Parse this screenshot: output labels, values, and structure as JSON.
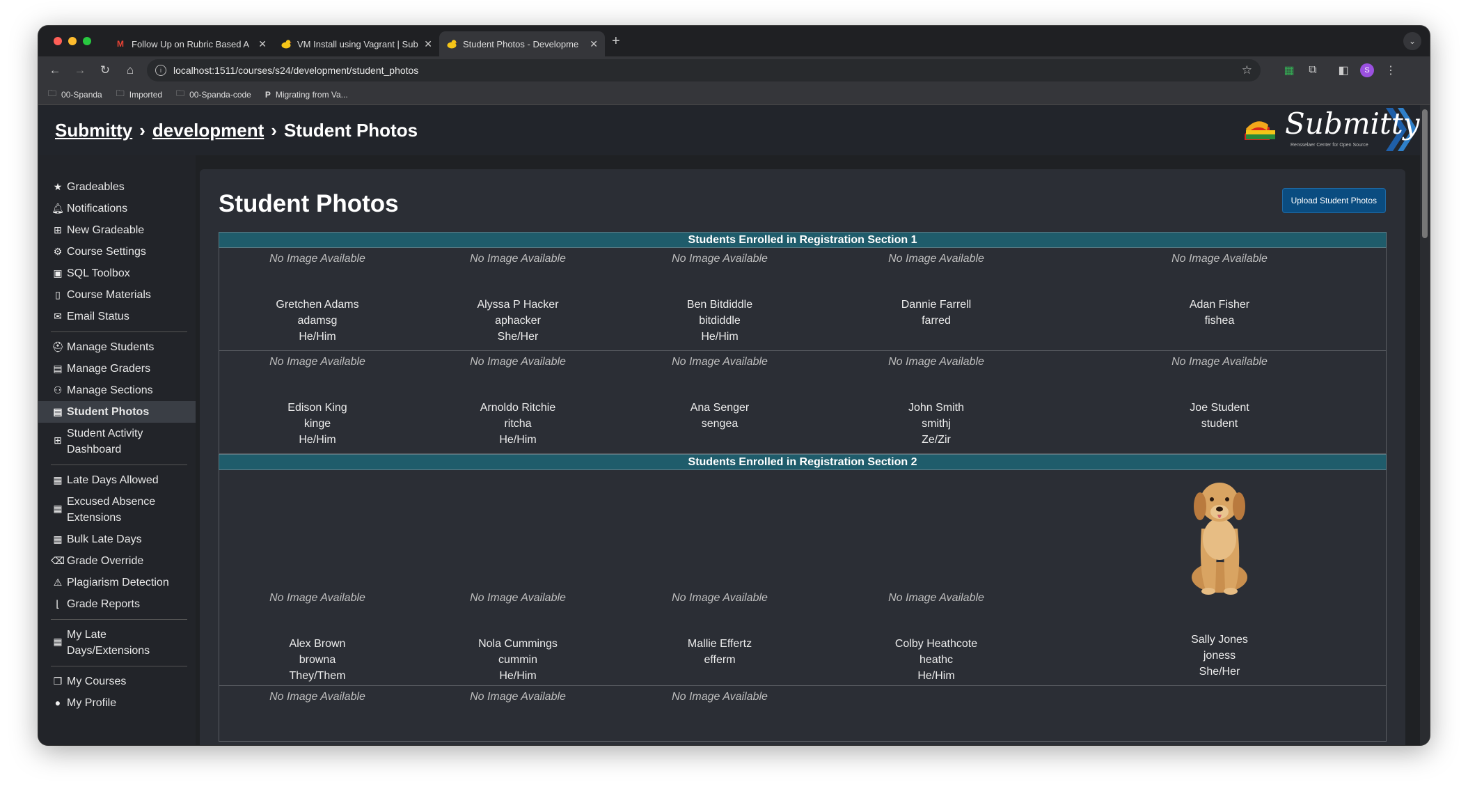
{
  "browser": {
    "tabs": [
      {
        "title": "Follow Up on Rubric Based A",
        "icon": "gmail-icon"
      },
      {
        "title": "VM Install using Vagrant | Sub",
        "icon": "submitty-duck-icon"
      },
      {
        "title": "Student Photos - Developme",
        "icon": "submitty-duck-icon",
        "active": true
      }
    ],
    "url": "localhost:1511/courses/s24/development/student_photos",
    "bookmarks": [
      "00-Spanda",
      "Imported",
      "00-Spanda-code",
      "Migrating from Va..."
    ]
  },
  "header": {
    "crumb_site": "Submitty",
    "crumb_course": "development",
    "crumb_page": "Student Photos",
    "logo_text": "Submitty",
    "logo_subtext": "Rensselaer Center for Open Source"
  },
  "sidebar": {
    "items": [
      {
        "label": "Gradeables",
        "icon": "star-icon"
      },
      {
        "label": "Notifications",
        "icon": "bell-icon"
      },
      {
        "label": "New Gradeable",
        "icon": "plus-square-icon"
      },
      {
        "label": "Course Settings",
        "icon": "gear-icon"
      },
      {
        "label": "SQL Toolbox",
        "icon": "toolbox-icon"
      },
      {
        "label": "Course Materials",
        "icon": "file-icon"
      },
      {
        "label": "Email Status",
        "icon": "envelope-icon"
      },
      {
        "label": "Manage Students",
        "icon": "user-graduate-icon"
      },
      {
        "label": "Manage Graders",
        "icon": "id-card-icon"
      },
      {
        "label": "Manage Sections",
        "icon": "users-icon"
      },
      {
        "label": "Student Photos",
        "icon": "id-badge-icon",
        "active": true
      },
      {
        "label": "Student Activity Dashboard",
        "icon": "table-icon"
      },
      {
        "label": "Late Days Allowed",
        "icon": "calendar-check-icon"
      },
      {
        "label": "Excused Absence Extensions",
        "icon": "calendar-plus-icon"
      },
      {
        "label": "Bulk Late Days",
        "icon": "calendar-grid-icon"
      },
      {
        "label": "Grade Override",
        "icon": "eraser-icon"
      },
      {
        "label": "Plagiarism Detection",
        "icon": "warning-icon"
      },
      {
        "label": "Grade Reports",
        "icon": "chart-line-icon"
      },
      {
        "label": "My Late Days/Extensions",
        "icon": "calendar-icon"
      },
      {
        "label": "My Courses",
        "icon": "cubes-icon"
      },
      {
        "label": "My Profile",
        "icon": "user-icon"
      }
    ]
  },
  "main": {
    "title": "Student Photos",
    "upload_button": "Upload Student Photos",
    "no_image_text": "No Image Available",
    "sections": [
      {
        "heading": "Students Enrolled in Registration Section 1",
        "rows": [
          [
            {
              "name": "Gretchen Adams",
              "id": "adamsg",
              "pronouns": "He/Him"
            },
            {
              "name": "Alyssa P Hacker",
              "id": "aphacker",
              "pronouns": "She/Her"
            },
            {
              "name": "Ben Bitdiddle",
              "id": "bitdiddle",
              "pronouns": "He/Him"
            },
            {
              "name": "Dannie Farrell",
              "id": "farred",
              "pronouns": ""
            },
            {
              "name": "Adan Fisher",
              "id": "fishea",
              "pronouns": ""
            }
          ],
          [
            {
              "name": "Edison King",
              "id": "kinge",
              "pronouns": "He/Him"
            },
            {
              "name": "Arnoldo Ritchie",
              "id": "ritcha",
              "pronouns": "He/Him"
            },
            {
              "name": "Ana Senger",
              "id": "sengea",
              "pronouns": ""
            },
            {
              "name": "John Smith",
              "id": "smithj",
              "pronouns": "Ze/Zir"
            },
            {
              "name": "Joe Student",
              "id": "student",
              "pronouns": ""
            }
          ]
        ]
      },
      {
        "heading": "Students Enrolled in Registration Section 2",
        "rows": [
          [
            {
              "name": "Alex Brown",
              "id": "browna",
              "pronouns": "They/Them"
            },
            {
              "name": "Nola Cummings",
              "id": "cummin",
              "pronouns": "He/Him"
            },
            {
              "name": "Mallie Effertz",
              "id": "efferm",
              "pronouns": ""
            },
            {
              "name": "Colby Heathcote",
              "id": "heathc",
              "pronouns": "He/Him"
            },
            {
              "name": "Sally Jones",
              "id": "joness",
              "pronouns": "She/Her",
              "photo": "golden-retriever-puppy-photo"
            }
          ]
        ]
      }
    ]
  }
}
